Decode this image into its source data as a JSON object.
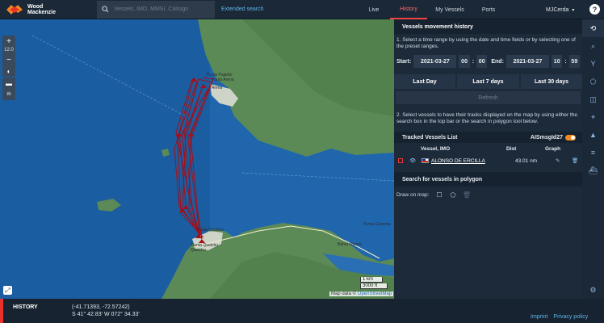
{
  "brand": {
    "line1": "Wood",
    "line2": "Mackenzie"
  },
  "search": {
    "placeholder": "Vessels, IMO, MMSI, Callsign",
    "extended_label": "Extended search"
  },
  "nav": {
    "tabs": [
      {
        "label": "Live"
      },
      {
        "label": "History"
      },
      {
        "label": "My Vessels"
      },
      {
        "label": "Ports"
      }
    ],
    "active": "History"
  },
  "user": {
    "name": "MJCerda"
  },
  "map": {
    "zoom_level": "12.0",
    "scale": {
      "km": "1 km",
      "ft": "3000 ft"
    },
    "attribution_prefix": "Map data ©",
    "attribution_link": "OpenStreetMap",
    "places": [
      {
        "label": "Punta Pajarito"
      },
      {
        "label": "Punta Arena"
      },
      {
        "label": "Arena"
      },
      {
        "label": "Punta Quelchu"
      },
      {
        "label": "Quelchu"
      },
      {
        "label": "Punta Carreras"
      },
      {
        "label": "Punta Quelchu"
      },
      {
        "label": "Bahía Manao"
      }
    ],
    "track_color": "#a30f1a"
  },
  "panel": {
    "title": "Vessels movement history",
    "instruction1": "1. Select a time range by using the date and time fields or by selecting one of the preset ranges.",
    "start_label": "Start:",
    "start_date": "2021-03-27",
    "start_hour": "00",
    "start_min": "00",
    "end_label": "End:",
    "end_date": "2021-03-27",
    "end_hour": "10",
    "end_min": "59",
    "presets": [
      "Last Day",
      "Last 7 days",
      "Last 30 days"
    ],
    "refresh_label": "Refresh",
    "instruction2": "2. Select vessels to have their tracks displayed on the map by using either the search box in the top bar or the search in polygon tool below.",
    "tracked_title": "Tracked Vessels List",
    "ais_label": "AISmsgId27",
    "columns": {
      "vessel": "Vessel, IMO",
      "dist": "Dist",
      "graph": "Graph"
    },
    "vessels": [
      {
        "name": "ALONSO DE ERCILLA",
        "dist": "43.01 nm"
      }
    ],
    "polygon_title": "Search for vessels in polygon",
    "draw_label": "Draw on map:"
  },
  "footer": {
    "mode": "HISTORY",
    "coords_decimal": "(-41.71393, -72.57242)",
    "coords_dms": "S 41° 42.83' W 072° 34.33'",
    "imprint": "Imprint",
    "privacy": "Privacy policy"
  },
  "colors": {
    "accent": "#e8322b",
    "link": "#5fb6e6",
    "toggle": "#f08a24"
  }
}
